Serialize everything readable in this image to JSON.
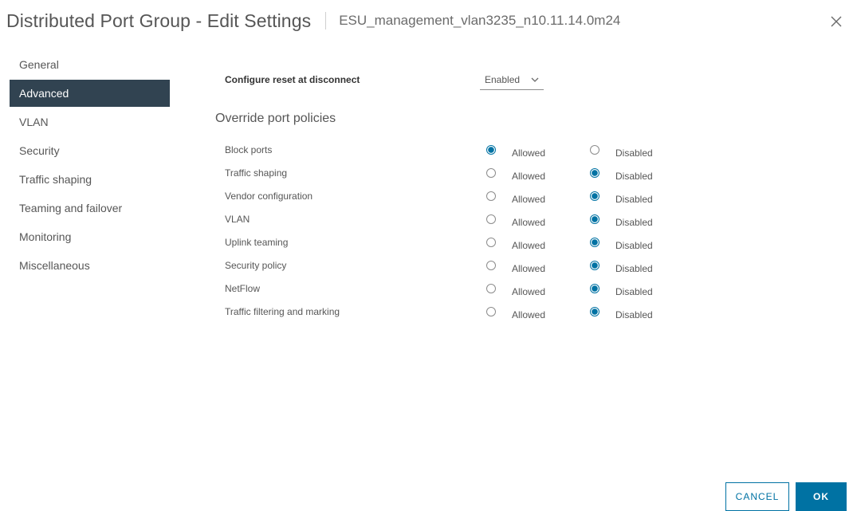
{
  "header": {
    "title": "Distributed Port Group - Edit Settings",
    "subtitle": "ESU_management_vlan3235_n10.11.14.0m24",
    "close_icon": "close-icon"
  },
  "sidebar": {
    "items": [
      {
        "label": "General",
        "active": false
      },
      {
        "label": "Advanced",
        "active": true
      },
      {
        "label": "VLAN",
        "active": false
      },
      {
        "label": "Security",
        "active": false
      },
      {
        "label": "Traffic shaping",
        "active": false
      },
      {
        "label": "Teaming and failover",
        "active": false
      },
      {
        "label": "Monitoring",
        "active": false
      },
      {
        "label": "Miscellaneous",
        "active": false
      }
    ]
  },
  "main": {
    "reset_label": "Configure reset at disconnect",
    "reset_value": "Enabled",
    "section_title": "Override port policies",
    "allowed_label": "Allowed",
    "disabled_label": "Disabled",
    "policies": [
      {
        "name": "Block ports",
        "selected": "allowed"
      },
      {
        "name": "Traffic shaping",
        "selected": "disabled"
      },
      {
        "name": "Vendor configuration",
        "selected": "disabled"
      },
      {
        "name": "VLAN",
        "selected": "disabled"
      },
      {
        "name": "Uplink teaming",
        "selected": "disabled"
      },
      {
        "name": "Security policy",
        "selected": "disabled"
      },
      {
        "name": "NetFlow",
        "selected": "disabled"
      },
      {
        "name": "Traffic filtering and marking",
        "selected": "disabled"
      }
    ]
  },
  "footer": {
    "cancel_label": "CANCEL",
    "ok_label": "OK"
  },
  "colors": {
    "accent": "#0072a3",
    "nav_active_bg": "#314351"
  }
}
